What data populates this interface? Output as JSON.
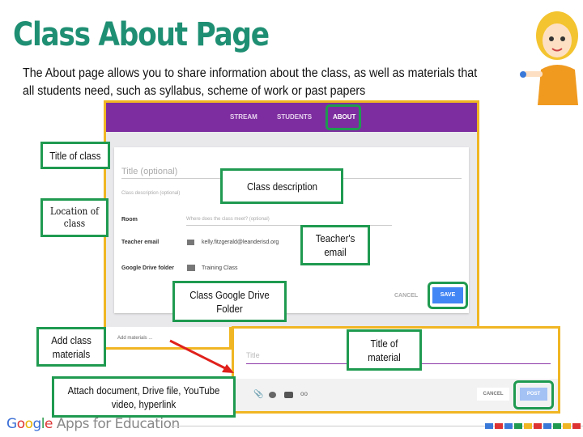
{
  "title": "Class About Page",
  "subtitle": "The About page allows you to share information about the class, as well as materials that all students need, such as syllabus, scheme of work or past papers",
  "classroom": {
    "tabs": [
      "STREAM",
      "STUDENTS",
      "ABOUT"
    ],
    "active_tab": "ABOUT",
    "title_placeholder": "Title (optional)",
    "description_placeholder": "Class description (optional)",
    "room_label": "Room",
    "room_placeholder": "Where does the class meet? (optional)",
    "email_label": "Teacher email",
    "email_value": "kelly.fitzgerald@leanderisd.org",
    "drive_label": "Google Drive folder",
    "drive_value": "Training Class",
    "cancel": "CANCEL",
    "save": "SAVE",
    "add_materials": "Add materials ...",
    "material_title_placeholder": "Title",
    "material_cancel": "CANCEL",
    "post": "POST",
    "accent": "#7d2d9f",
    "attach_icons": [
      "paperclip-icon",
      "drive-icon",
      "youtube-icon",
      "link-icon"
    ]
  },
  "callouts": {
    "title_of_class": "Title of class",
    "class_description": "Class description",
    "location": "Location of class",
    "teacher_email": "Teacher's email",
    "drive_folder": "Class Google Drive Folder",
    "add_materials": "Add class materials",
    "title_of_material": "Title of material",
    "attach": "Attach document, Drive file, YouTube video, hyperlink"
  },
  "footer": {
    "logo": "Google Apps for Education"
  },
  "colors": {
    "title": "#1f8f73",
    "callout_border": "#1f9a50",
    "highlight": "#f0b623",
    "arrow": "#e0201b"
  }
}
